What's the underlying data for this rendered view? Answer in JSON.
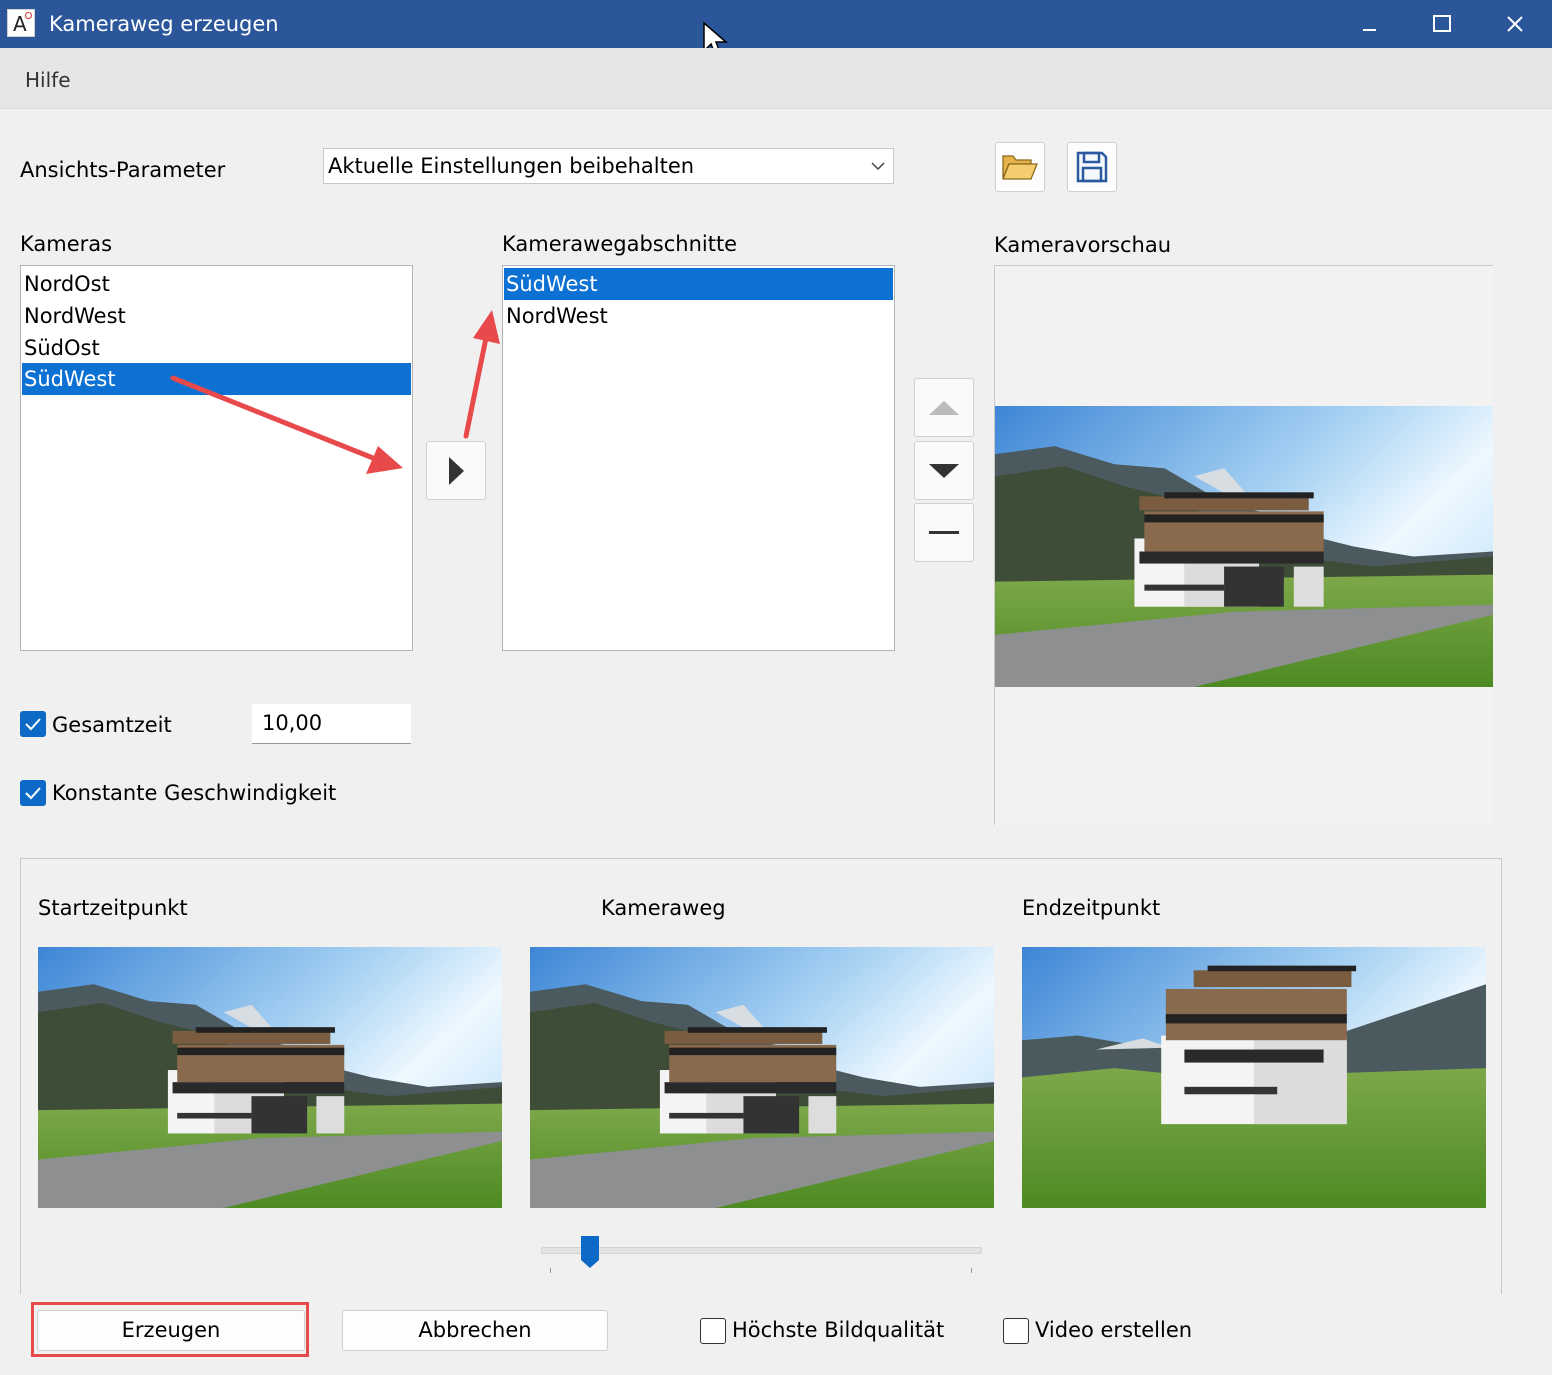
{
  "window": {
    "title": "Kameraweg erzeugen",
    "app_icon_letter": "A"
  },
  "menu": {
    "items": [
      {
        "label": "Hilfe"
      }
    ]
  },
  "view_params": {
    "label": "Ansichts-Parameter",
    "selected": "Aktuelle Einstellungen beibehalten"
  },
  "cameras": {
    "label": "Kameras",
    "items": [
      "NordOst",
      "NordWest",
      "SüdOst",
      "SüdWest"
    ],
    "selected_index": 3
  },
  "segments": {
    "label": "Kamerawegabschnitte",
    "items": [
      "SüdWest",
      "NordWest"
    ],
    "selected_index": 0
  },
  "preview": {
    "label": "Kameravorschau"
  },
  "total_time": {
    "label": "Gesamtzeit",
    "checked": true,
    "value": "10,00"
  },
  "constant_speed": {
    "label": "Konstante Geschwindigkeit",
    "checked": true
  },
  "timeline": {
    "start_label": "Startzeitpunkt",
    "path_label": "Kameraweg",
    "end_label": "Endzeitpunkt",
    "slider_position": 0.11
  },
  "footer": {
    "create_button": "Erzeugen",
    "cancel_button": "Abbrechen",
    "quality_checkbox": {
      "label": "Höchste Bildqualität",
      "checked": false
    },
    "video_checkbox": {
      "label": "Video erstellen",
      "checked": false
    }
  },
  "colors": {
    "title_bar": "#2b579a",
    "selection": "#0c71d2",
    "checkbox": "#0c6ac6",
    "annotation": "#e8494a"
  }
}
